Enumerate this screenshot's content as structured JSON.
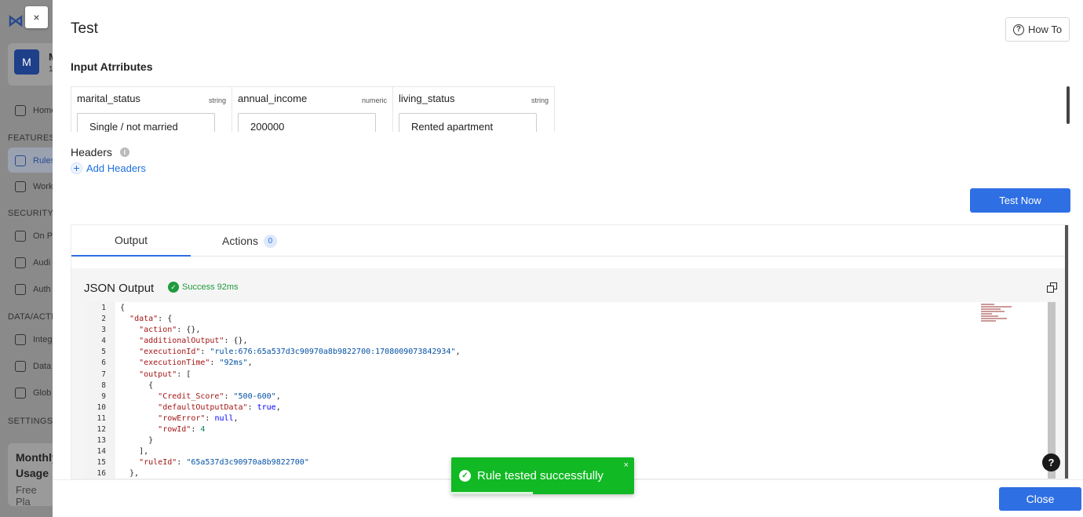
{
  "background": {
    "org_avatar": "M",
    "org_name": "M",
    "org_sub": "1",
    "nav": [
      {
        "label": "Home",
        "icon": "home-icon"
      },
      {
        "label": "Rules",
        "icon": "rules-icon"
      },
      {
        "label": "Work",
        "icon": "workflow-icon"
      },
      {
        "label": "On P",
        "icon": "on-prem-icon"
      },
      {
        "label": "Audi",
        "icon": "audit-icon"
      },
      {
        "label": "Auth",
        "icon": "key-icon"
      },
      {
        "label": "Integ",
        "icon": "plug-icon"
      },
      {
        "label": "Data",
        "icon": "data-icon"
      },
      {
        "label": "Glob",
        "icon": "globe-icon"
      }
    ],
    "sections": [
      "FEATURES",
      "SECURITY",
      "DATA/ACTI",
      "SETTINGS"
    ],
    "usage_title_1": "Monthly",
    "usage_title_2": "Usage",
    "usage_plan": "Free Pla"
  },
  "modal": {
    "close_x": "×",
    "title": "Test",
    "how_to": "How To",
    "input_attributes_label": "Input Atrributes",
    "attributes": [
      {
        "name": "marital_status",
        "type": "string",
        "value": "Single / not married"
      },
      {
        "name": "annual_income",
        "type": "numeric",
        "value": "200000"
      },
      {
        "name": "living_status",
        "type": "string",
        "value": "Rented apartment"
      }
    ],
    "headers_label": "Headers",
    "add_headers": "Add Headers",
    "test_now": "Test Now",
    "tabs": [
      {
        "label": "Output"
      },
      {
        "label": "Actions",
        "count": "0"
      }
    ],
    "json_output_label": "JSON Output",
    "success_text": "Success 92ms",
    "close": "Close"
  },
  "code_lines": [
    {
      "n": "1",
      "text": "{"
    },
    {
      "n": "2",
      "text": "  \"data\": {"
    },
    {
      "n": "3",
      "text": "    \"action\": {},"
    },
    {
      "n": "4",
      "text": "    \"additionalOutput\": {},"
    },
    {
      "n": "5",
      "text": "    \"executionId\": \"rule:676:65a537d3c90970a8b9822700:1708009073842934\","
    },
    {
      "n": "6",
      "text": "    \"executionTime\": \"92ms\","
    },
    {
      "n": "7",
      "text": "    \"output\": ["
    },
    {
      "n": "8",
      "text": "      {"
    },
    {
      "n": "9",
      "text": "        \"Credit_Score\": \"500-600\","
    },
    {
      "n": "10",
      "text": "        \"defaultOutputData\": true,"
    },
    {
      "n": "11",
      "text": "        \"rowError\": null,"
    },
    {
      "n": "12",
      "text": "        \"rowId\": 4"
    },
    {
      "n": "13",
      "text": "      }"
    },
    {
      "n": "14",
      "text": "    ],"
    },
    {
      "n": "15",
      "text": "    \"ruleId\": \"65a537d3c90970a8b9822700\""
    },
    {
      "n": "16",
      "text": "  },"
    }
  ],
  "toast": {
    "message": "Rule tested successfully",
    "close": "×",
    "color": "#11b924"
  },
  "colors": {
    "primary": "#2f6fe4",
    "success": "#1f9a3c"
  },
  "help_button": "?"
}
